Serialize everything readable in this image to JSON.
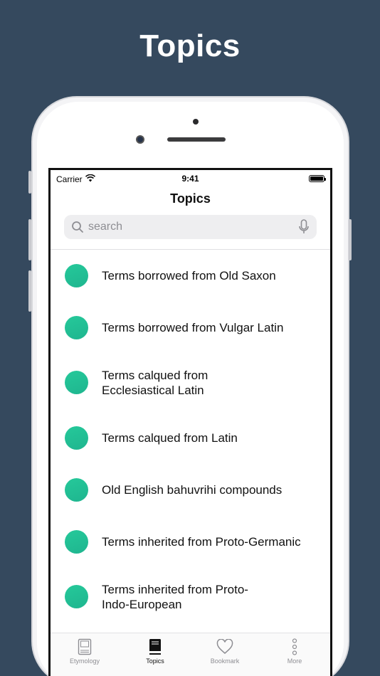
{
  "headline": "Topics",
  "status_bar": {
    "carrier": "Carrier",
    "time": "9:41"
  },
  "nav": {
    "title": "Topics"
  },
  "search": {
    "placeholder": "search"
  },
  "topics": [
    {
      "label": "Terms borrowed from Old Saxon"
    },
    {
      "label": "Terms borrowed from Vulgar Latin"
    },
    {
      "label": "Terms calqued from Ecclesiastical Latin"
    },
    {
      "label": "Terms calqued from Latin"
    },
    {
      "label": "Old English bahuvrihi compounds"
    },
    {
      "label": "Terms inherited from Proto-Germanic"
    },
    {
      "label": "Terms inherited from Proto-Indo-European"
    }
  ],
  "tabs": [
    {
      "label": "Etymology",
      "icon": "book-outline-icon"
    },
    {
      "label": "Topics",
      "icon": "book-filled-icon"
    },
    {
      "label": "Bookmark",
      "icon": "heart-icon"
    },
    {
      "label": "More",
      "icon": "more-dots-icon"
    }
  ],
  "colors": {
    "background": "#35495e",
    "accent": "#1fb58f"
  }
}
